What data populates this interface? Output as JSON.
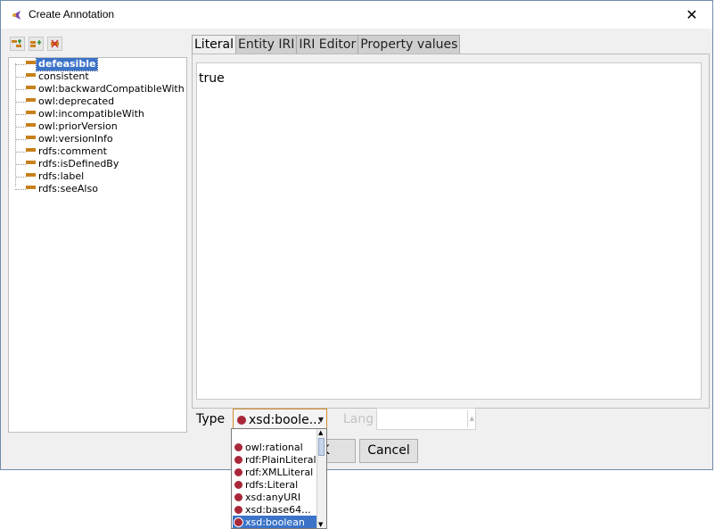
{
  "window": {
    "title": "Create Annotation",
    "close_label": "✕"
  },
  "tree": {
    "items": [
      {
        "label": "defeasible",
        "selected": true
      },
      {
        "label": "consistent"
      },
      {
        "label": "owl:backwardCompatibleWith"
      },
      {
        "label": "owl:deprecated"
      },
      {
        "label": "owl:incompatibleWith"
      },
      {
        "label": "owl:priorVersion"
      },
      {
        "label": "owl:versionInfo"
      },
      {
        "label": "rdfs:comment"
      },
      {
        "label": "rdfs:isDefinedBy"
      },
      {
        "label": "rdfs:label"
      },
      {
        "label": "rdfs:seeAlso"
      }
    ]
  },
  "tabs": [
    {
      "label": "Literal",
      "active": true
    },
    {
      "label": "Entity IRI"
    },
    {
      "label": "IRI Editor"
    },
    {
      "label": "Property values"
    }
  ],
  "literal": {
    "value": "true"
  },
  "type": {
    "label": "Type",
    "selected": "xsd:boole..."
  },
  "lang": {
    "label": "Lang",
    "value": ""
  },
  "buttons": {
    "ok": "K",
    "cancel": "Cancel"
  },
  "dropdown": {
    "items": [
      {
        "label": "owl:rational"
      },
      {
        "label": "rdf:PlainLiteral"
      },
      {
        "label": "rdf:XMLLiteral"
      },
      {
        "label": "rdfs:Literal"
      },
      {
        "label": "xsd:anyURI"
      },
      {
        "label": "xsd:base64..."
      },
      {
        "label": "xsd:boolean",
        "selected": true
      }
    ]
  },
  "colors": {
    "accent": "#3b73c8",
    "property_icon": "#c8801c",
    "datatype_dot": "#a8283a",
    "focus_border": "#d48a2a"
  }
}
